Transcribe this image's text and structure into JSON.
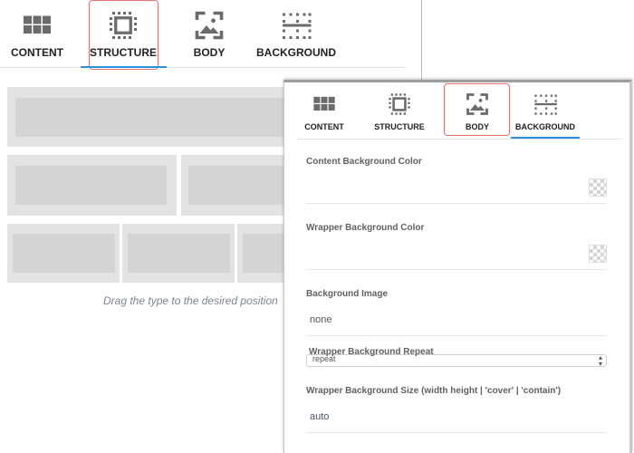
{
  "back_panel": {
    "tabs": [
      {
        "label": "CONTENT",
        "icon": "grid-icon"
      },
      {
        "label": "STRUCTURE",
        "icon": "structure-icon"
      },
      {
        "label": "BODY",
        "icon": "image-icon"
      },
      {
        "label": "BACKGROUND",
        "icon": "background-icon"
      }
    ],
    "active_tab": "STRUCTURE",
    "drag_hint": "Drag the type to the desired position"
  },
  "front_panel": {
    "tabs": [
      {
        "label": "CONTENT",
        "icon": "grid-icon"
      },
      {
        "label": "STRUCTURE",
        "icon": "structure-icon"
      },
      {
        "label": "BODY",
        "icon": "image-icon"
      },
      {
        "label": "BACKGROUND",
        "icon": "background-icon"
      }
    ],
    "active_tab": "BACKGROUND",
    "highlighted_tab": "BODY",
    "fields": {
      "content_bg_color": {
        "label": "Content Background Color",
        "value": ""
      },
      "wrapper_bg_color": {
        "label": "Wrapper Background Color",
        "value": ""
      },
      "background_image": {
        "label": "Background Image",
        "value": "none"
      },
      "wrapper_bg_repeat": {
        "label": "Wrapper Background Repeat",
        "value": "repeat"
      },
      "wrapper_bg_size": {
        "label": "Wrapper Background Size (width height | 'cover' | 'contain')",
        "value": "auto"
      }
    }
  },
  "colors": {
    "accent": "#2d8fe0",
    "highlight_outline": "#e57373",
    "icon": "#6b6b6b"
  }
}
